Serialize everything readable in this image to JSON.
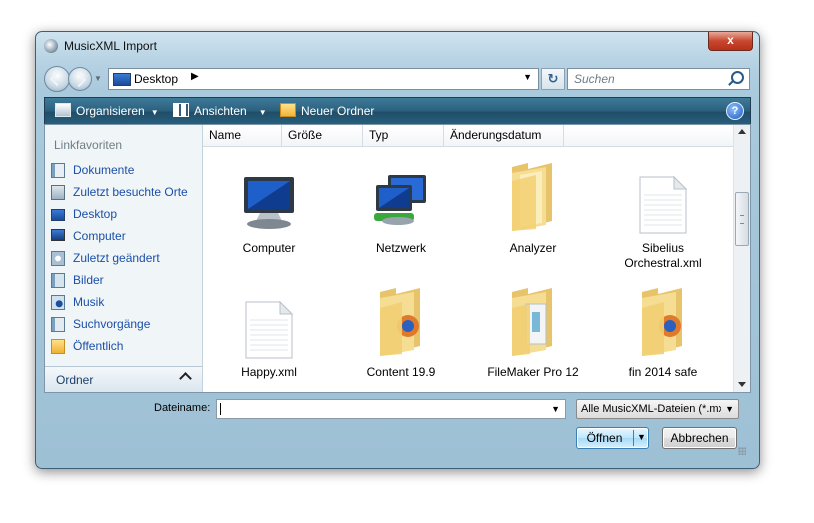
{
  "window": {
    "title": "MusicXML Import",
    "close_label": "x"
  },
  "address": {
    "location": "Desktop",
    "search_placeholder": "Suchen"
  },
  "toolbar": {
    "organize": "Organisieren",
    "views": "Ansichten",
    "new_folder": "Neuer Ordner",
    "help": "?"
  },
  "sidebar": {
    "heading": "Linkfavoriten",
    "items": [
      {
        "label": "Dokumente",
        "icon": "documents-icon"
      },
      {
        "label": "Zuletzt besuchte Orte",
        "icon": "recent-places-icon"
      },
      {
        "label": "Desktop",
        "icon": "desktop-icon"
      },
      {
        "label": "Computer",
        "icon": "computer-icon"
      },
      {
        "label": "Zuletzt geändert",
        "icon": "recently-changed-icon"
      },
      {
        "label": "Bilder",
        "icon": "pictures-icon"
      },
      {
        "label": "Musik",
        "icon": "music-icon"
      },
      {
        "label": "Suchvorgänge",
        "icon": "searches-icon"
      },
      {
        "label": "Öffentlich",
        "icon": "public-folder-icon"
      }
    ],
    "folders_label": "Ordner"
  },
  "columns": [
    "Name",
    "Größe",
    "Typ",
    "Änderungsdatum"
  ],
  "files": [
    {
      "name": "Computer",
      "icon": "computer-icon"
    },
    {
      "name": "Netzwerk",
      "icon": "network-icon"
    },
    {
      "name": "Analyzer",
      "icon": "folder-icon"
    },
    {
      "name": "Sibelius Orchestral.xml",
      "icon": "document-icon"
    },
    {
      "name": "Happy.xml",
      "icon": "document-icon"
    },
    {
      "name": "Content 19.9",
      "icon": "folder-icon"
    },
    {
      "name": "FileMaker Pro 12",
      "icon": "folder-icon"
    },
    {
      "name": "fin 2014 safe",
      "icon": "folder-icon"
    }
  ],
  "footer": {
    "filename_label": "Dateiname:",
    "filename_value": "",
    "filter_value": "Alle MusicXML-Dateien (*.mxl",
    "open_label": "Öffnen",
    "cancel_label": "Abbrechen"
  }
}
